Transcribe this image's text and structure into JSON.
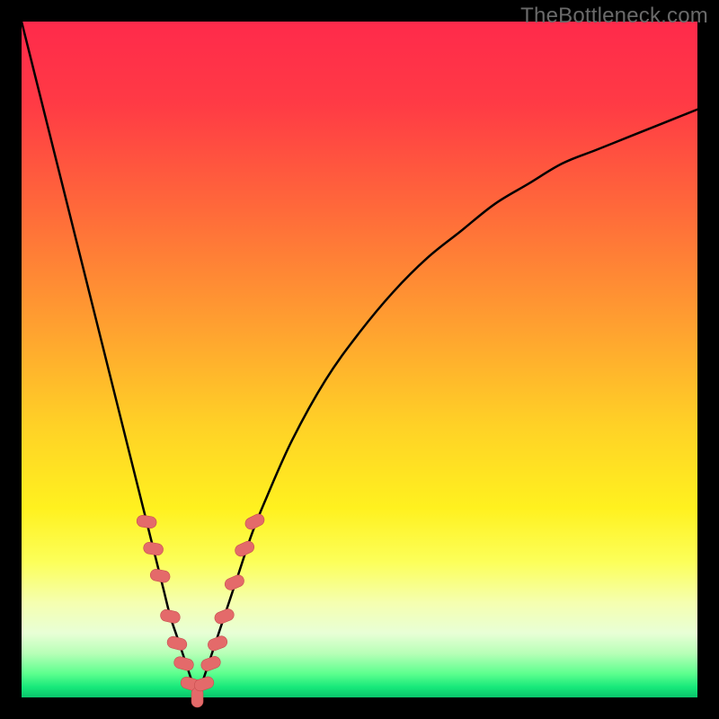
{
  "watermark": {
    "text": "TheBottleneck.com"
  },
  "colors": {
    "black": "#000000",
    "curve_stroke": "#000000",
    "marker_fill": "#e46a6a",
    "marker_stroke": "#c74f4f",
    "gradient_stops": [
      {
        "offset": 0.0,
        "color": "#ff2a4b"
      },
      {
        "offset": 0.12,
        "color": "#ff3a45"
      },
      {
        "offset": 0.28,
        "color": "#ff6a3a"
      },
      {
        "offset": 0.45,
        "color": "#ffa030"
      },
      {
        "offset": 0.6,
        "color": "#ffd226"
      },
      {
        "offset": 0.72,
        "color": "#fff11f"
      },
      {
        "offset": 0.8,
        "color": "#fcff5a"
      },
      {
        "offset": 0.86,
        "color": "#f5ffb0"
      },
      {
        "offset": 0.905,
        "color": "#e8ffd6"
      },
      {
        "offset": 0.935,
        "color": "#b7ffb7"
      },
      {
        "offset": 0.965,
        "color": "#5cff8e"
      },
      {
        "offset": 0.985,
        "color": "#17e87a"
      },
      {
        "offset": 1.0,
        "color": "#09c56b"
      }
    ]
  },
  "chart_data": {
    "type": "line",
    "title": "",
    "xlabel": "",
    "ylabel": "",
    "xlim": [
      0,
      100
    ],
    "ylim": [
      0,
      100
    ],
    "series": [
      {
        "name": "left-branch",
        "x": [
          0,
          2,
          4,
          6,
          8,
          10,
          12,
          14,
          16,
          18,
          19,
          20,
          21,
          22,
          23,
          24,
          25,
          26
        ],
        "y": [
          100,
          92,
          84,
          76,
          68,
          60,
          52,
          44,
          36,
          28,
          24,
          20,
          16,
          12,
          9,
          6,
          3,
          0
        ]
      },
      {
        "name": "right-branch",
        "x": [
          26,
          28,
          30,
          32,
          34,
          36,
          40,
          45,
          50,
          55,
          60,
          65,
          70,
          75,
          80,
          85,
          90,
          95,
          100
        ],
        "y": [
          0,
          6,
          12,
          18,
          24,
          29,
          38,
          47,
          54,
          60,
          65,
          69,
          73,
          76,
          79,
          81,
          83,
          85,
          87
        ]
      }
    ],
    "markers": {
      "name": "highlighted-segments",
      "points": [
        {
          "x": 18.5,
          "y": 26
        },
        {
          "x": 19.5,
          "y": 22
        },
        {
          "x": 20.5,
          "y": 18
        },
        {
          "x": 22.0,
          "y": 12
        },
        {
          "x": 23.0,
          "y": 8
        },
        {
          "x": 24.0,
          "y": 5
        },
        {
          "x": 25.0,
          "y": 2
        },
        {
          "x": 26.0,
          "y": 0
        },
        {
          "x": 27.0,
          "y": 2
        },
        {
          "x": 28.0,
          "y": 5
        },
        {
          "x": 29.0,
          "y": 8
        },
        {
          "x": 30.0,
          "y": 12
        },
        {
          "x": 31.5,
          "y": 17
        },
        {
          "x": 33.0,
          "y": 22
        },
        {
          "x": 34.5,
          "y": 26
        }
      ]
    }
  }
}
